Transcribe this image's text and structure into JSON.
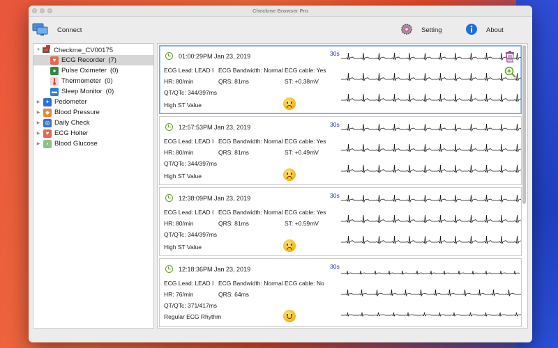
{
  "window": {
    "title": "Checkme Browser Pro"
  },
  "toolbar": {
    "connect_label": "Connect",
    "setting_label": "Setting",
    "about_label": "About"
  },
  "sidebar": {
    "device": "Checkme_CV00175",
    "items": [
      {
        "label": "ECG Recorder",
        "count": "(7)",
        "icon": "heart-icon",
        "color": "#e5694f"
      },
      {
        "label": "Pulse Oximeter",
        "count": "(0)",
        "icon": "drop-icon",
        "color": "#2e8b3e"
      },
      {
        "label": "Thermometer",
        "count": "(0)",
        "icon": "thermometer-icon",
        "color": "#e04a4a"
      },
      {
        "label": "Sleep Monitor",
        "count": "(0)",
        "icon": "bed-icon",
        "color": "#2f7fd1"
      },
      {
        "label": "Pedometer",
        "count": "",
        "icon": "runner-icon",
        "color": "#2f6fd1"
      },
      {
        "label": "Blood Pressure",
        "count": "",
        "icon": "cuff-icon",
        "color": "#e28a3a"
      },
      {
        "label": "Daily Check",
        "count": "",
        "icon": "stethoscope-icon",
        "color": "#3f6fd1"
      },
      {
        "label": "ECG Holter",
        "count": "",
        "icon": "heart-icon",
        "color": "#e5694f"
      },
      {
        "label": "Blood Glucose",
        "count": "",
        "icon": "glucose-icon",
        "color": "#8fbf8a"
      }
    ]
  },
  "records": [
    {
      "time": "01:00:29PM Jan 23, 2019",
      "duration": "30s",
      "lead": "ECG Lead: LEAD I",
      "bandwidth": "ECG Bandwidth: Normal",
      "cable": "ECG cable: Yes",
      "hr": "HR: 80/min",
      "qrs": "QRS: 81ms",
      "st": "ST: +0.38mV",
      "qt": "QT/QTc: 344/397ms",
      "result": "High ST Value",
      "mood": "sad"
    },
    {
      "time": "12:57:53PM Jan 23, 2019",
      "duration": "30s",
      "lead": "ECG Lead: LEAD I",
      "bandwidth": "ECG Bandwidth: Normal",
      "cable": "ECG cable: Yes",
      "hr": "HR: 80/min",
      "qrs": "QRS: 81ms",
      "st": "ST: +0.49mV",
      "qt": "QT/QTc: 344/397ms",
      "result": "High ST Value",
      "mood": "sad"
    },
    {
      "time": "12:38:09PM Jan 23, 2019",
      "duration": "30s",
      "lead": "ECG Lead: LEAD I",
      "bandwidth": "ECG Bandwidth: Normal",
      "cable": "ECG cable: Yes",
      "hr": "HR: 80/min",
      "qrs": "QRS: 81ms",
      "st": "ST: +0.59mV",
      "qt": "QT/QTc: 344/397ms",
      "result": "High ST Value",
      "mood": "sad"
    },
    {
      "time": "12:18:36PM Jan 23, 2019",
      "duration": "30s",
      "lead": "ECG Lead: LEAD I",
      "bandwidth": "ECG Bandwidth: Normal",
      "cable": "ECG cable: No",
      "hr": "HR: 76/min",
      "qrs": "QRS: 64ms",
      "st": "",
      "qt": "QT/QTc: 371/417ms",
      "result": "Regular ECG Rhythm",
      "mood": "happy"
    }
  ]
}
